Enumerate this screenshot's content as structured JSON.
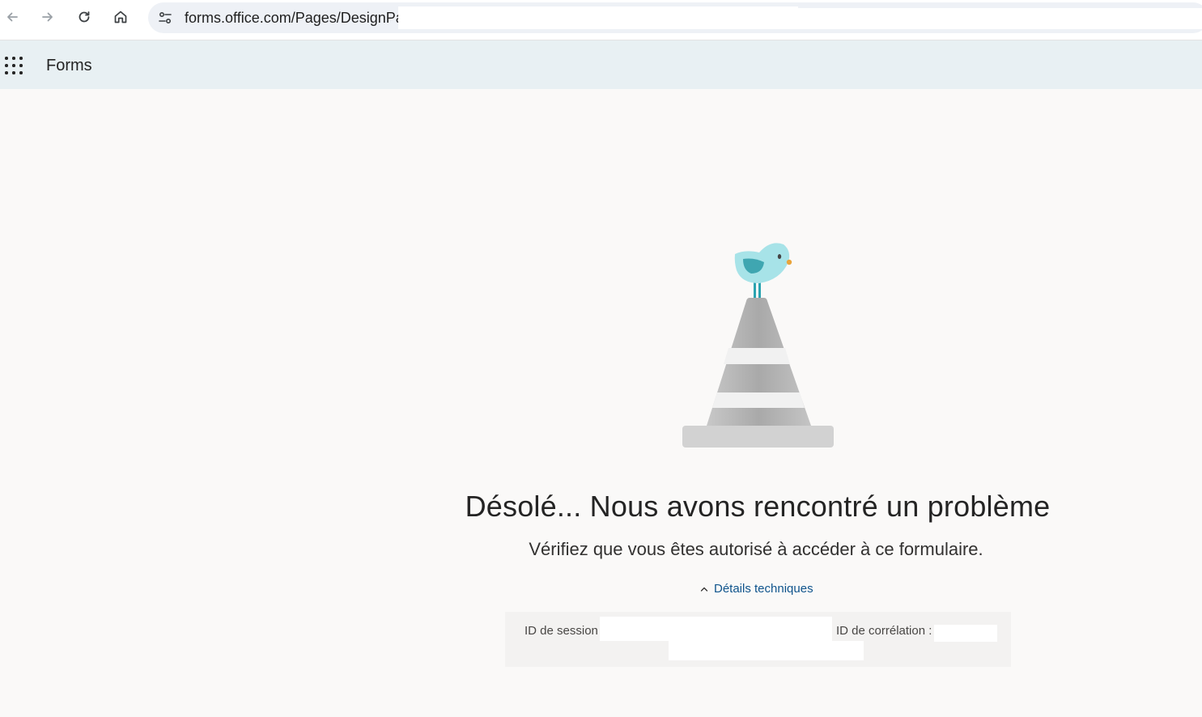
{
  "browser": {
    "url_text": "forms.office.com/Pages/DesignPag",
    "back_icon": "arrow-left-icon",
    "forward_icon": "arrow-right-icon",
    "reload_icon": "reload-icon",
    "home_icon": "home-icon",
    "site_info_icon": "tune-icon"
  },
  "app_header": {
    "app_name": "Forms",
    "launcher_icon": "waffle-icon"
  },
  "error": {
    "title": "Désolé... Nous avons rencontré un problème",
    "message": "Vérifiez que vous êtes autorisé à accéder à ce formulaire.",
    "details_toggle_label": "Détails techniques",
    "details_toggle_icon": "chevron-up-icon",
    "session_id_label": "ID de session :",
    "correlation_id_label": "ID de corrélation :"
  },
  "colors": {
    "page_background": "#faf9f8",
    "header_background": "#e8f0f3",
    "link_color": "#0f548c",
    "details_background": "#f3f2f1"
  }
}
